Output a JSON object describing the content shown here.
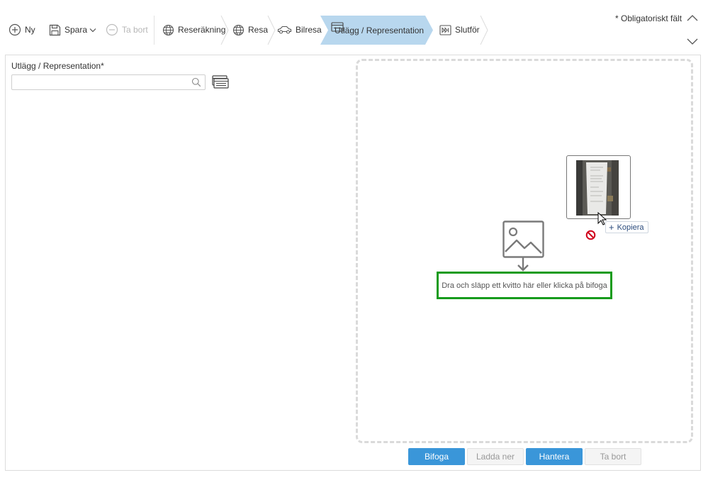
{
  "toolbar": {
    "new_label": "Ny",
    "save_label": "Spara",
    "delete_label": "Ta bort",
    "steps": {
      "expense_report": "Reseräkning",
      "trip": "Resa",
      "car_trip": "Bilresa",
      "expenses": "Utlägg / Representation",
      "finish": "Slutför"
    },
    "required_note": "* Obligatoriskt fält",
    "active_step_color": "#b8d7ee"
  },
  "form": {
    "field_label": "Utlägg / Representation*",
    "search_value": "",
    "search_placeholder": ""
  },
  "attachment": {
    "drop_text": "Dra och släpp ett kvitto här eller klicka på bifoga",
    "highlight_color": "#179b1c",
    "drag_tooltip": "Kopiera",
    "buttons": {
      "attach": "Bifoga",
      "download": "Ladda ner",
      "manage": "Hantera",
      "delete": "Ta bort"
    }
  },
  "colors": {
    "primary_button": "#3a96d9",
    "disabled_text": "#b7b7b7",
    "no_drop": "#d0021b"
  },
  "icons": {
    "new": "plus-circle-icon",
    "save": "floppy-disk-icon",
    "delete": "minus-circle-icon",
    "steps": "globe-icon",
    "car": "car-icon",
    "expenses": "receipt-card-icon",
    "finish": "skip-forward-icon",
    "search": "search-icon",
    "list": "card-stack-icon",
    "drop": "image-arrow-down-icon"
  }
}
